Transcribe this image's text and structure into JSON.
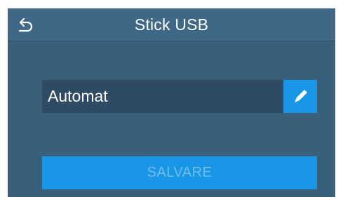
{
  "header": {
    "title": "Stick USB",
    "back_icon": "back-arrow-icon"
  },
  "form": {
    "name_value": "Automat",
    "edit_icon": "pencil-icon"
  },
  "actions": {
    "save_label": "SALVARE",
    "save_enabled": false
  },
  "colors": {
    "background": "#3a5f7b",
    "titlebar": "#3f6886",
    "field": "#2f4b63",
    "accent": "#1a96e6",
    "disabled_text": "#6fbcef"
  }
}
